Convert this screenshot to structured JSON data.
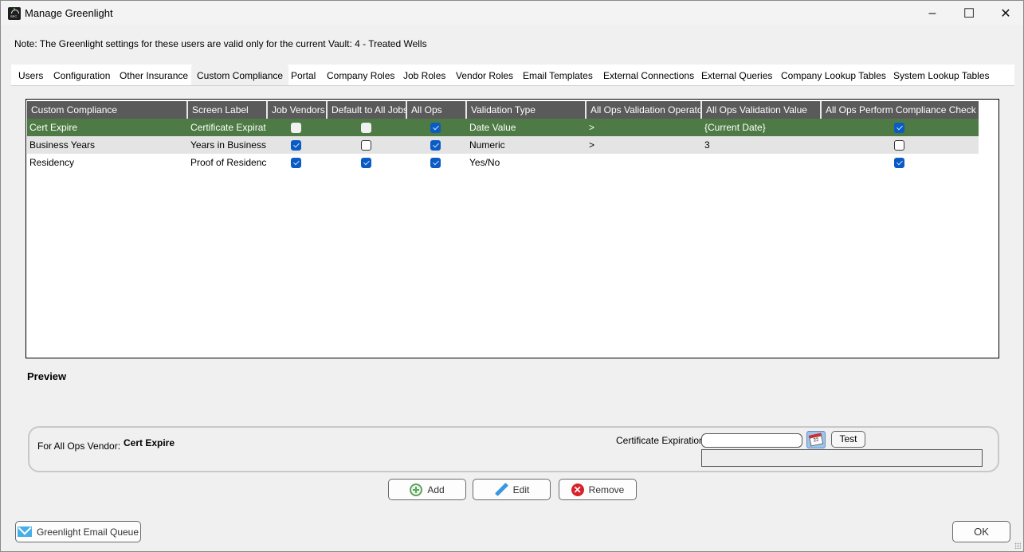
{
  "window": {
    "title": "Manage Greenlight",
    "icon": "greenlight-app-icon",
    "controls": {
      "minimize": "–",
      "maximize": "☐",
      "close": "✕"
    }
  },
  "note": "Note:  The Greenlight settings for these users are valid only for the current Vault: 4 - Treated Wells",
  "tabs": [
    {
      "label": "Users",
      "active": false
    },
    {
      "label": "Configuration",
      "active": false
    },
    {
      "label": "Other Insurance",
      "active": false
    },
    {
      "label": "Custom Compliance",
      "active": true
    },
    {
      "label": "Portal",
      "active": false
    },
    {
      "label": "Company Roles",
      "active": false
    },
    {
      "label": "Job Roles",
      "active": false
    },
    {
      "label": "Vendor Roles",
      "active": false
    },
    {
      "label": "Email Templates",
      "active": false
    },
    {
      "label": "External Connections",
      "active": false
    },
    {
      "label": "External Queries",
      "active": false
    },
    {
      "label": "Company Lookup Tables",
      "active": false
    },
    {
      "label": "System Lookup Tables",
      "active": false
    }
  ],
  "grid": {
    "columns": [
      "Custom Compliance",
      "Screen Label",
      "Job Vendors",
      "Default to All Jobs",
      "All Ops",
      "Validation Type",
      "All Ops Validation Operator",
      "All Ops Validation Value",
      "All Ops Perform Compliance Check"
    ],
    "rows": [
      {
        "name": "Cert Expire",
        "screen_label": "Certificate Expirati...",
        "job_vendors": false,
        "default_all_jobs": false,
        "all_ops": true,
        "validation_type": "Date Value",
        "operator": ">",
        "value": "{Current Date}",
        "perform_check": true,
        "selected": true
      },
      {
        "name": "Business Years",
        "screen_label": "Years in Business",
        "job_vendors": true,
        "default_all_jobs": false,
        "all_ops": true,
        "validation_type": "Numeric",
        "operator": ">",
        "value": "3",
        "perform_check": false,
        "selected": false
      },
      {
        "name": "Residency",
        "screen_label": "Proof of Residency",
        "job_vendors": true,
        "default_all_jobs": true,
        "all_ops": true,
        "validation_type": "Yes/No",
        "operator": "",
        "value": "",
        "perform_check": true,
        "selected": false
      }
    ]
  },
  "preview": {
    "heading": "Preview",
    "vendor_label": "For All Ops Vendor:",
    "vendor_name": "Cert Expire",
    "field_label": "Certificate Expiration",
    "field_value": "",
    "test_label": "Test",
    "message": ""
  },
  "actions": {
    "add": "Add",
    "edit": "Edit",
    "remove": "Remove"
  },
  "footer": {
    "email_queue": "Greenlight Email Queue",
    "ok": "OK"
  }
}
